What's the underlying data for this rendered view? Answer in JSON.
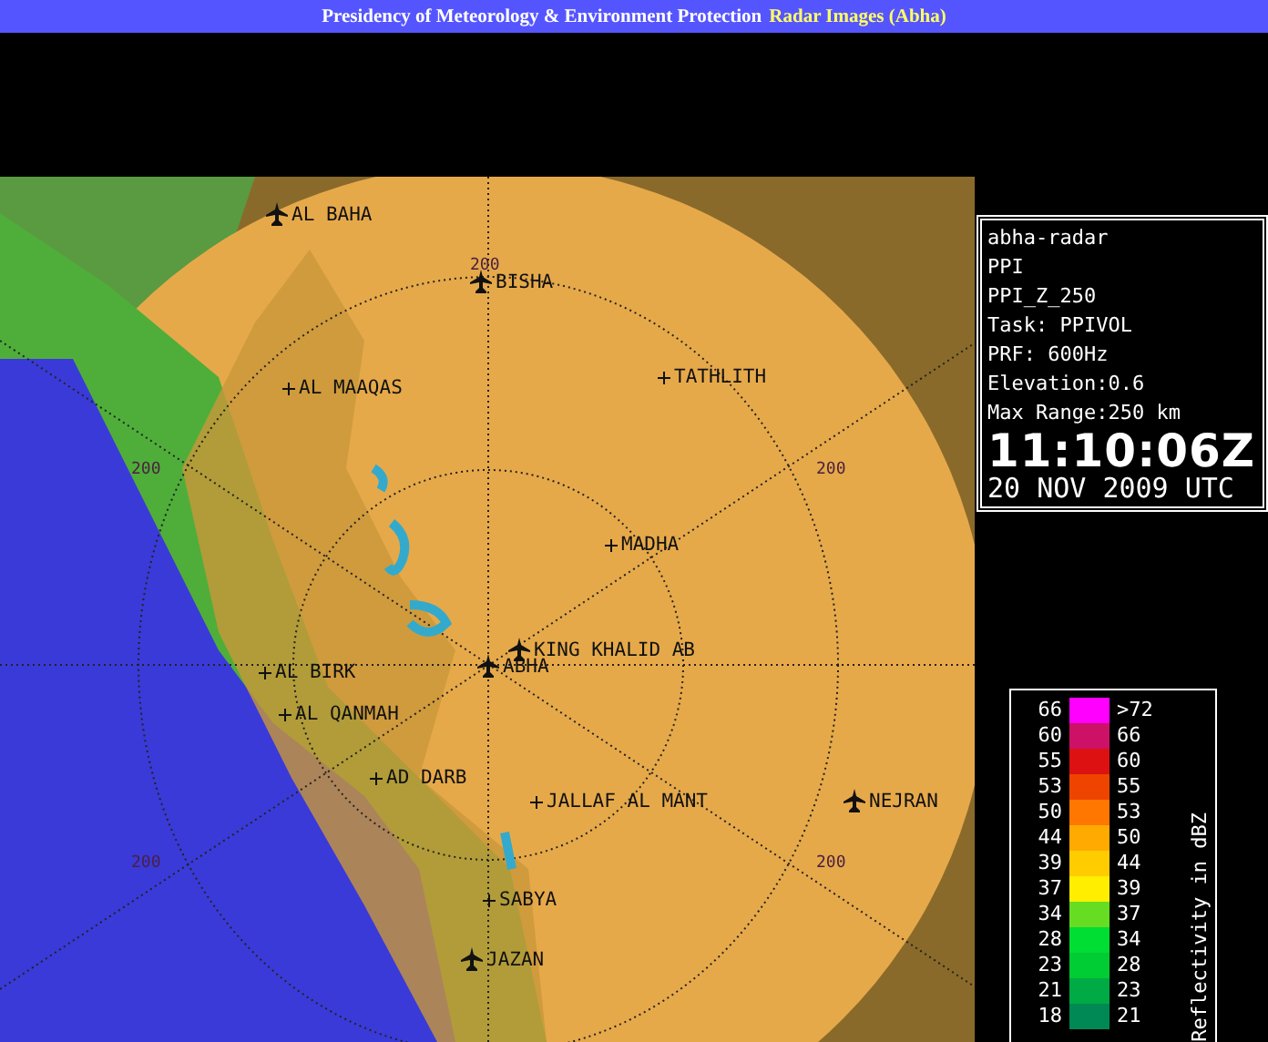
{
  "header": {
    "title": "Presidency of Meteorology & Environment Protection",
    "subtitle": "Radar Images (Abha)"
  },
  "map": {
    "places": [
      {
        "name": "AL BAHA",
        "kind": "airport"
      },
      {
        "name": "BISHA",
        "kind": "airport"
      },
      {
        "name": "AL MAAQAS",
        "kind": "town"
      },
      {
        "name": "TATHLITH",
        "kind": "town"
      },
      {
        "name": "MADHA",
        "kind": "town"
      },
      {
        "name": "KING KHALID AB",
        "kind": "airport"
      },
      {
        "name": "ABHA",
        "kind": "airport"
      },
      {
        "name": "AL BIRK",
        "kind": "town"
      },
      {
        "name": "AL QANMAH",
        "kind": "town"
      },
      {
        "name": "AD DARB",
        "kind": "town"
      },
      {
        "name": "JALLAF AL MANT",
        "kind": "town"
      },
      {
        "name": "NEJRAN",
        "kind": "airport"
      },
      {
        "name": "SABYA",
        "kind": "town"
      },
      {
        "name": "JAZAN",
        "kind": "airport"
      }
    ],
    "range_labels": [
      "200",
      "200",
      "200",
      "200",
      "200"
    ]
  },
  "info": {
    "lines": [
      "abha-radar",
      "PPI",
      "PPI_Z_250",
      "Task: PPIVOL",
      "PRF: 600Hz",
      "Elevation:0.6",
      "Max Range:250 km"
    ],
    "time": "11:10:06Z",
    "date": "20 NOV 2009 UTC"
  },
  "legend": {
    "title": "Reflectivity in dBZ",
    "rows": [
      {
        "low": "66",
        "high": ">72",
        "color": "#ff00ff"
      },
      {
        "low": "60",
        "high": "66",
        "color": "#cc1166"
      },
      {
        "low": "55",
        "high": "60",
        "color": "#dd1111"
      },
      {
        "low": "53",
        "high": "55",
        "color": "#ee4400"
      },
      {
        "low": "50",
        "high": "53",
        "color": "#ff7700"
      },
      {
        "low": "44",
        "high": "50",
        "color": "#ffaa00"
      },
      {
        "low": "39",
        "high": "44",
        "color": "#ffcc00"
      },
      {
        "low": "37",
        "high": "39",
        "color": "#ffee00"
      },
      {
        "low": "34",
        "high": "37",
        "color": "#66dd22"
      },
      {
        "low": "28",
        "high": "34",
        "color": "#00dd33"
      },
      {
        "low": "23",
        "high": "28",
        "color": "#00cc33"
      },
      {
        "low": "21",
        "high": "23",
        "color": "#00aa44"
      },
      {
        "low": "18",
        "high": "21",
        "color": "#008855"
      }
    ]
  }
}
